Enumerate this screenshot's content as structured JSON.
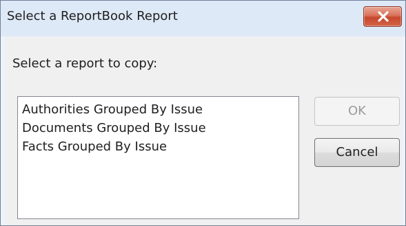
{
  "window": {
    "title": "Select a ReportBook Report",
    "close_icon": "close-icon"
  },
  "dialog": {
    "prompt": "Select a report to copy:",
    "reports": [
      "Authorities Grouped By Issue",
      "Documents Grouped By Issue",
      "Facts Grouped By Issue"
    ],
    "ok_label": "OK",
    "ok_enabled": false,
    "cancel_label": "Cancel"
  },
  "colors": {
    "close_button": "#d9725b",
    "title_bar": "#dee9f7",
    "dialog_face": "#f0f0f0"
  }
}
